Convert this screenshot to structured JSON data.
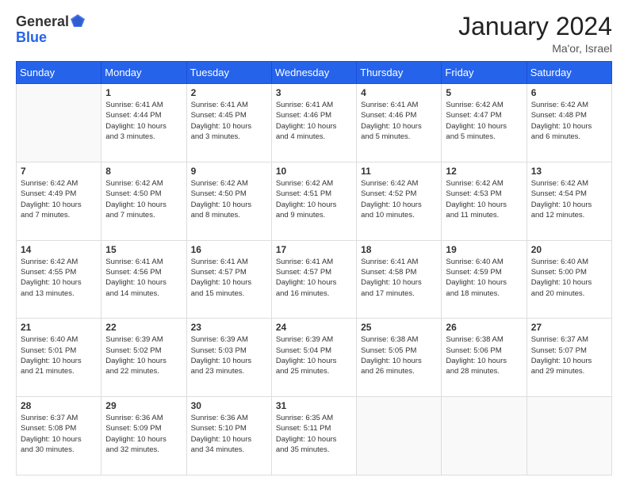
{
  "header": {
    "logo_general": "General",
    "logo_blue": "Blue",
    "month_title": "January 2024",
    "location": "Ma'or, Israel"
  },
  "days_of_week": [
    "Sunday",
    "Monday",
    "Tuesday",
    "Wednesday",
    "Thursday",
    "Friday",
    "Saturday"
  ],
  "weeks": [
    [
      {
        "num": "",
        "info": ""
      },
      {
        "num": "1",
        "info": "Sunrise: 6:41 AM\nSunset: 4:44 PM\nDaylight: 10 hours\nand 3 minutes."
      },
      {
        "num": "2",
        "info": "Sunrise: 6:41 AM\nSunset: 4:45 PM\nDaylight: 10 hours\nand 3 minutes."
      },
      {
        "num": "3",
        "info": "Sunrise: 6:41 AM\nSunset: 4:46 PM\nDaylight: 10 hours\nand 4 minutes."
      },
      {
        "num": "4",
        "info": "Sunrise: 6:41 AM\nSunset: 4:46 PM\nDaylight: 10 hours\nand 5 minutes."
      },
      {
        "num": "5",
        "info": "Sunrise: 6:42 AM\nSunset: 4:47 PM\nDaylight: 10 hours\nand 5 minutes."
      },
      {
        "num": "6",
        "info": "Sunrise: 6:42 AM\nSunset: 4:48 PM\nDaylight: 10 hours\nand 6 minutes."
      }
    ],
    [
      {
        "num": "7",
        "info": "Sunrise: 6:42 AM\nSunset: 4:49 PM\nDaylight: 10 hours\nand 7 minutes."
      },
      {
        "num": "8",
        "info": "Sunrise: 6:42 AM\nSunset: 4:50 PM\nDaylight: 10 hours\nand 7 minutes."
      },
      {
        "num": "9",
        "info": "Sunrise: 6:42 AM\nSunset: 4:50 PM\nDaylight: 10 hours\nand 8 minutes."
      },
      {
        "num": "10",
        "info": "Sunrise: 6:42 AM\nSunset: 4:51 PM\nDaylight: 10 hours\nand 9 minutes."
      },
      {
        "num": "11",
        "info": "Sunrise: 6:42 AM\nSunset: 4:52 PM\nDaylight: 10 hours\nand 10 minutes."
      },
      {
        "num": "12",
        "info": "Sunrise: 6:42 AM\nSunset: 4:53 PM\nDaylight: 10 hours\nand 11 minutes."
      },
      {
        "num": "13",
        "info": "Sunrise: 6:42 AM\nSunset: 4:54 PM\nDaylight: 10 hours\nand 12 minutes."
      }
    ],
    [
      {
        "num": "14",
        "info": "Sunrise: 6:42 AM\nSunset: 4:55 PM\nDaylight: 10 hours\nand 13 minutes."
      },
      {
        "num": "15",
        "info": "Sunrise: 6:41 AM\nSunset: 4:56 PM\nDaylight: 10 hours\nand 14 minutes."
      },
      {
        "num": "16",
        "info": "Sunrise: 6:41 AM\nSunset: 4:57 PM\nDaylight: 10 hours\nand 15 minutes."
      },
      {
        "num": "17",
        "info": "Sunrise: 6:41 AM\nSunset: 4:57 PM\nDaylight: 10 hours\nand 16 minutes."
      },
      {
        "num": "18",
        "info": "Sunrise: 6:41 AM\nSunset: 4:58 PM\nDaylight: 10 hours\nand 17 minutes."
      },
      {
        "num": "19",
        "info": "Sunrise: 6:40 AM\nSunset: 4:59 PM\nDaylight: 10 hours\nand 18 minutes."
      },
      {
        "num": "20",
        "info": "Sunrise: 6:40 AM\nSunset: 5:00 PM\nDaylight: 10 hours\nand 20 minutes."
      }
    ],
    [
      {
        "num": "21",
        "info": "Sunrise: 6:40 AM\nSunset: 5:01 PM\nDaylight: 10 hours\nand 21 minutes."
      },
      {
        "num": "22",
        "info": "Sunrise: 6:39 AM\nSunset: 5:02 PM\nDaylight: 10 hours\nand 22 minutes."
      },
      {
        "num": "23",
        "info": "Sunrise: 6:39 AM\nSunset: 5:03 PM\nDaylight: 10 hours\nand 23 minutes."
      },
      {
        "num": "24",
        "info": "Sunrise: 6:39 AM\nSunset: 5:04 PM\nDaylight: 10 hours\nand 25 minutes."
      },
      {
        "num": "25",
        "info": "Sunrise: 6:38 AM\nSunset: 5:05 PM\nDaylight: 10 hours\nand 26 minutes."
      },
      {
        "num": "26",
        "info": "Sunrise: 6:38 AM\nSunset: 5:06 PM\nDaylight: 10 hours\nand 28 minutes."
      },
      {
        "num": "27",
        "info": "Sunrise: 6:37 AM\nSunset: 5:07 PM\nDaylight: 10 hours\nand 29 minutes."
      }
    ],
    [
      {
        "num": "28",
        "info": "Sunrise: 6:37 AM\nSunset: 5:08 PM\nDaylight: 10 hours\nand 30 minutes."
      },
      {
        "num": "29",
        "info": "Sunrise: 6:36 AM\nSunset: 5:09 PM\nDaylight: 10 hours\nand 32 minutes."
      },
      {
        "num": "30",
        "info": "Sunrise: 6:36 AM\nSunset: 5:10 PM\nDaylight: 10 hours\nand 34 minutes."
      },
      {
        "num": "31",
        "info": "Sunrise: 6:35 AM\nSunset: 5:11 PM\nDaylight: 10 hours\nand 35 minutes."
      },
      {
        "num": "",
        "info": ""
      },
      {
        "num": "",
        "info": ""
      },
      {
        "num": "",
        "info": ""
      }
    ]
  ]
}
